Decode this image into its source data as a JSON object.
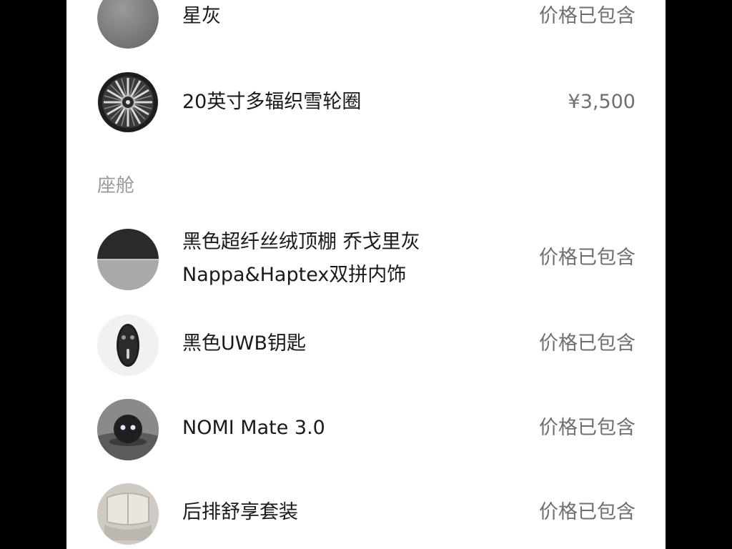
{
  "items_top": [
    {
      "name": "星灰",
      "price": "价格已包含",
      "icon": "gray-paint-swatch"
    },
    {
      "name": "20英寸多辐织雪轮圈",
      "price": "¥3,500",
      "icon": "wheel-rim"
    }
  ],
  "cabin": {
    "title": "座舱",
    "items": [
      {
        "name_line1": "黑色超纤丝绒顶棚 乔戈里灰",
        "name_line2": "Nappa&Haptex双拼内饰",
        "price": "价格已包含",
        "icon": "interior-material-swatch"
      },
      {
        "name": "黑色UWB钥匙",
        "price": "价格已包含",
        "icon": "car-key"
      },
      {
        "name": "NOMI Mate 3.0",
        "price": "价格已包含",
        "icon": "nomi-robot"
      },
      {
        "name": "后排舒享套装",
        "price": "价格已包含",
        "icon": "rear-seat"
      }
    ]
  }
}
